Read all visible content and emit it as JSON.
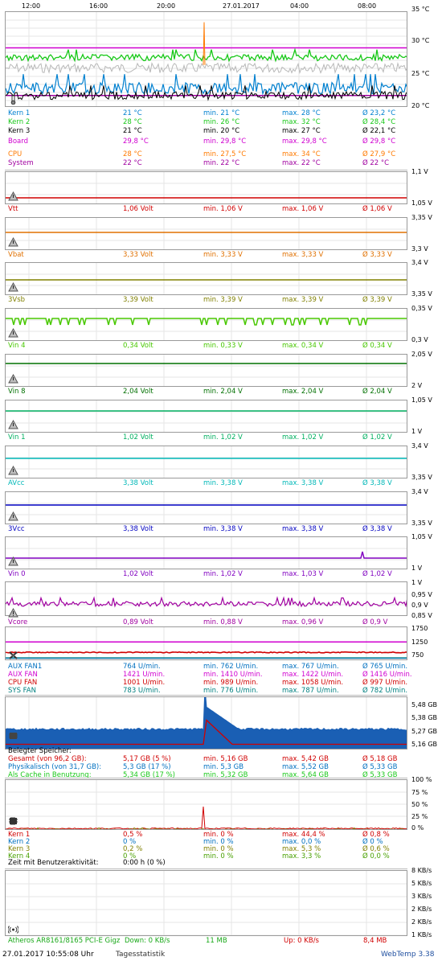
{
  "header": {
    "times": [
      "12:00",
      "16:00",
      "20:00",
      "27.01.2017",
      "04:00",
      "08:00"
    ]
  },
  "temperature": {
    "axis": [
      "35 °C",
      "30 °C",
      "25 °C",
      "20 °C"
    ],
    "rows": [
      {
        "label": "Kern 1",
        "current": "21 °C",
        "min": "min. 21 °C",
        "max": "max. 28 °C",
        "avg": "Ø 23,2 °C",
        "color": "#0080d0"
      },
      {
        "label": "Kern 2",
        "current": "28 °C",
        "min": "min. 26 °C",
        "max": "max. 32 °C",
        "avg": "Ø 28,4 °C",
        "color": "#18c818"
      },
      {
        "label": "Kern 3",
        "current": "21 °C",
        "min": "min. 20 °C",
        "max": "max. 27 °C",
        "avg": "Ø 22,1 °C",
        "color": "#000000"
      },
      {
        "label": "Board",
        "current": "29,8 °C",
        "min": "min. 29,8 °C",
        "max": "max. 29,8 °C",
        "avg": "Ø 29,8 °C",
        "color": "#d000d0"
      },
      {
        "label": "CPU",
        "current": "28 °C",
        "min": "min. 27,5 °C",
        "max": "max. 34 °C",
        "avg": "Ø 27,9 °C",
        "color": "#ff7a00"
      },
      {
        "label": "System",
        "current": "22 °C",
        "min": "min. 22 °C",
        "max": "max. 22 °C",
        "avg": "Ø 22 °C",
        "color": "#a000a0"
      }
    ]
  },
  "voltages": [
    {
      "axis_top": "1,1 V",
      "axis_bottom": "1,05 V",
      "label": "Vtt",
      "current": "1,06 Volt",
      "min": "min. 1,06 V",
      "max": "max. 1,06 V",
      "avg": "Ø 1,06 V",
      "color": "#d00000"
    },
    {
      "axis_top": "3,35 V",
      "axis_bottom": "3,3 V",
      "label": "Vbat",
      "current": "3,33 Volt",
      "min": "min. 3,33 V",
      "max": "max. 3,33 V",
      "avg": "Ø 3,33 V",
      "color": "#e07000"
    },
    {
      "axis_top": "3,4 V",
      "axis_bottom": "3,35 V",
      "label": "3Vsb",
      "current": "3,39 Volt",
      "min": "min. 3,39 V",
      "max": "max. 3,39 V",
      "avg": "Ø 3,39 V",
      "color": "#808000"
    },
    {
      "axis_top": "0,35 V",
      "axis_bottom": "0,3 V",
      "label": "Vin 4",
      "current": "0,34 Volt",
      "min": "min. 0,33 V",
      "max": "max. 0,34 V",
      "avg": "Ø 0,34 V",
      "color": "#48c800"
    },
    {
      "axis_top": "2,05 V",
      "axis_bottom": "2 V",
      "label": "Vin 8",
      "current": "2,04 Volt",
      "min": "min. 2,04 V",
      "max": "max. 2,04 V",
      "avg": "Ø 2,04 V",
      "color": "#007000"
    },
    {
      "axis_top": "1,05 V",
      "axis_bottom": "1 V",
      "label": "Vin 1",
      "current": "1,02 Volt",
      "min": "min. 1,02 V",
      "max": "max. 1,02 V",
      "avg": "Ø 1,02 V",
      "color": "#00b060"
    },
    {
      "axis_top": "3,4 V",
      "axis_bottom": "3,35 V",
      "label": "AVcc",
      "current": "3,38 Volt",
      "min": "min. 3,38 V",
      "max": "max. 3,38 V",
      "avg": "Ø 3,38 V",
      "color": "#00b8b8"
    },
    {
      "axis_top": "3,4 V",
      "axis_bottom": "3,35 V",
      "label": "3Vcc",
      "current": "3,38 Volt",
      "min": "min. 3,38 V",
      "max": "max. 3,38 V",
      "avg": "Ø 3,38 V",
      "color": "#0000c0"
    },
    {
      "axis_top": "1,05 V",
      "axis_bottom": "1 V",
      "label": "Vin 0",
      "current": "1,02 Volt",
      "min": "min. 1,02 V",
      "max": "max. 1,03 V",
      "avg": "Ø 1,02 V",
      "color": "#8000c0"
    }
  ],
  "vcore": {
    "axis": [
      "1 V",
      "0,95 V",
      "0,9 V",
      "0,85 V"
    ],
    "label": "Vcore",
    "current": "0,89 Volt",
    "min": "min. 0,88 V",
    "max": "max. 0,96 V",
    "avg": "Ø 0,9 V",
    "color": "#a000a0"
  },
  "fans": {
    "axis": [
      "1750",
      "1250",
      "750"
    ],
    "rows": [
      {
        "label": "AUX FAN1",
        "current": "764 U/min.",
        "min": "min. 762 U/min.",
        "max": "max. 767 U/min.",
        "avg": "Ø 765 U/min.",
        "color": "#0070c0"
      },
      {
        "label": "AUX FAN",
        "current": "1421 U/min.",
        "min": "min. 1410 U/min.",
        "max": "max. 1422 U/min.",
        "avg": "Ø 1416 U/min.",
        "color": "#d000d0"
      },
      {
        "label": "CPU FAN",
        "current": "1001 U/min.",
        "min": "min. 989 U/min.",
        "max": "max. 1058 U/min.",
        "avg": "Ø 997 U/min.",
        "color": "#d00000"
      },
      {
        "label": "SYS FAN",
        "current": "783 U/min.",
        "min": "min. 776 U/min.",
        "max": "max. 787 U/min.",
        "avg": "Ø 782 U/min.",
        "color": "#008080"
      }
    ]
  },
  "memory": {
    "axis": [
      "5,48 GB",
      "5,38 GB",
      "5,27 GB",
      "5,16 GB"
    ],
    "header": "Belegter Speicher:",
    "rows": [
      {
        "label": "Gesamt (von 96,2 GB):",
        "current": "5,17 GB (5 %)",
        "min": "min. 5,16 GB",
        "max": "max. 5,42 GB",
        "avg": "Ø 5,18 GB",
        "color": "#d00000"
      },
      {
        "label": "Physikalisch (von 31,7 GB):",
        "current": "5,3 GB (17 %)",
        "min": "min. 5,3 GB",
        "max": "max. 5,52 GB",
        "avg": "Ø 5,33 GB",
        "color": "#0070c0"
      },
      {
        "label": "Als Cache in Benutzung:",
        "current": "5,34 GB (17 %)",
        "min": "min. 5,32 GB",
        "max": "max. 5,64 GB",
        "avg": "Ø 5,33 GB",
        "color": "#18c818"
      }
    ]
  },
  "cpu": {
    "axis": [
      "100 %",
      "75 %",
      "50 %",
      "25 %",
      "0 %"
    ],
    "rows": [
      {
        "label": "Kern 1",
        "current": "0,5 %",
        "min": "min. 0 %",
        "max": "max. 44,4 %",
        "avg": "Ø 0,8 %",
        "color": "#d00000"
      },
      {
        "label": "Kern 2",
        "current": "0 %",
        "min": "min. 0 %",
        "max": "max. 0,0 %",
        "avg": "Ø 0 %",
        "color": "#0070c0"
      },
      {
        "label": "Kern 3",
        "current": "0,2 %",
        "min": "min. 0 %",
        "max": "max. 5,3 %",
        "avg": "Ø 0,6 %",
        "color": "#808000"
      },
      {
        "label": "Kern 4",
        "current": "0 %",
        "min": "min. 0 %",
        "max": "max. 3,3 %",
        "avg": "Ø 0,0 %",
        "color": "#48a000"
      }
    ],
    "activity_label": "Zeit mit Benutzeraktivität:",
    "activity_value": "0:00 h (0 %)"
  },
  "network": {
    "axis": [
      "8 KB/s",
      "5 KB/s",
      "3 KB/s",
      "2 KB/s",
      "2 KB/s",
      "1 KB/s"
    ],
    "adapter": "Atheros AR8161/8165 PCI-E Gigz",
    "down": "Down: 0 KB/s",
    "down_total": "11 MB",
    "up": "Up: 0 KB/s",
    "up_total": "8,4 MB"
  },
  "footer": {
    "datetime": "27.01.2017 10:55:08 Uhr",
    "link": "Tagesstatistik",
    "app": "WebTemp 3.38"
  }
}
